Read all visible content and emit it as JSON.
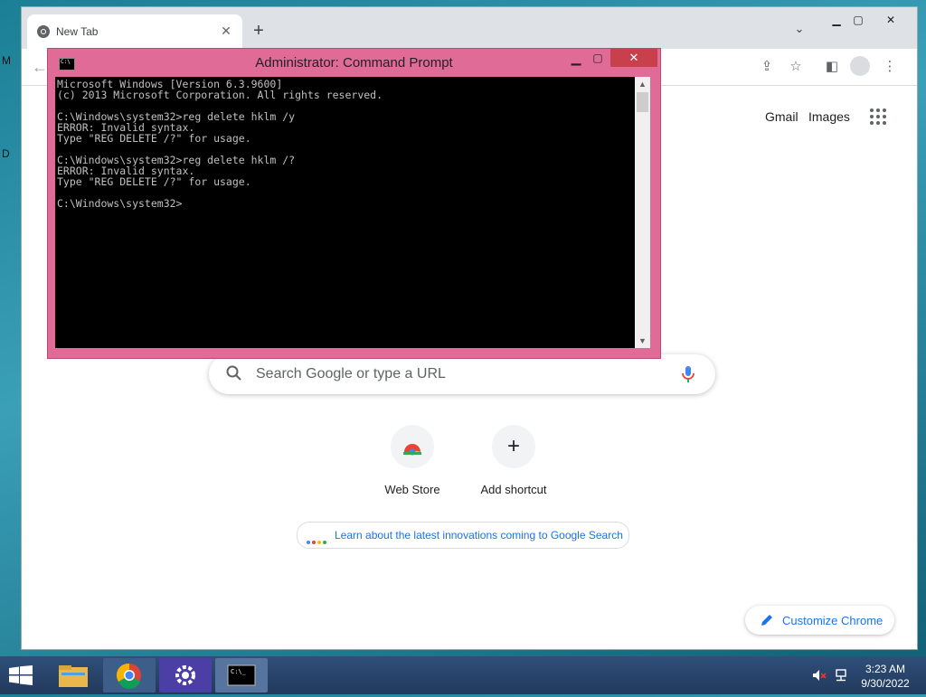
{
  "desktop": {
    "fragments": [
      "M",
      "D"
    ]
  },
  "browser": {
    "tab": {
      "title": "New Tab"
    },
    "top_links": {
      "gmail": "Gmail",
      "images": "Images"
    },
    "search": {
      "placeholder": "Search Google or type a URL"
    },
    "shortcuts": [
      {
        "label": "Web Store",
        "icon": "chrome-web-store-icon"
      },
      {
        "label": "Add shortcut",
        "icon": "plus-icon"
      }
    ],
    "promo": {
      "text": "Learn about the latest innovations coming to Google Search"
    },
    "customize": {
      "label": "Customize Chrome"
    }
  },
  "cmd": {
    "title": "Administrator: Command Prompt",
    "lines": [
      "Microsoft Windows [Version 6.3.9600]",
      "(c) 2013 Microsoft Corporation. All rights reserved.",
      "",
      "C:\\Windows\\system32>reg delete hklm /y",
      "ERROR: Invalid syntax.",
      "Type \"REG DELETE /?\" for usage.",
      "",
      "C:\\Windows\\system32>reg delete hklm /?",
      "ERROR: Invalid syntax.",
      "Type \"REG DELETE /?\" for usage.",
      "",
      "C:\\Windows\\system32>"
    ]
  },
  "taskbar": {
    "apps": [
      "file-explorer-icon",
      "chrome-icon",
      "settings-icon",
      "command-prompt-icon"
    ],
    "clock": {
      "time": "3:23 AM",
      "date": "9/30/2022"
    }
  },
  "colors": {
    "cmd_frame": "#e06b97",
    "link_blue": "#1a73e8",
    "taskbar": "#2a4268"
  }
}
